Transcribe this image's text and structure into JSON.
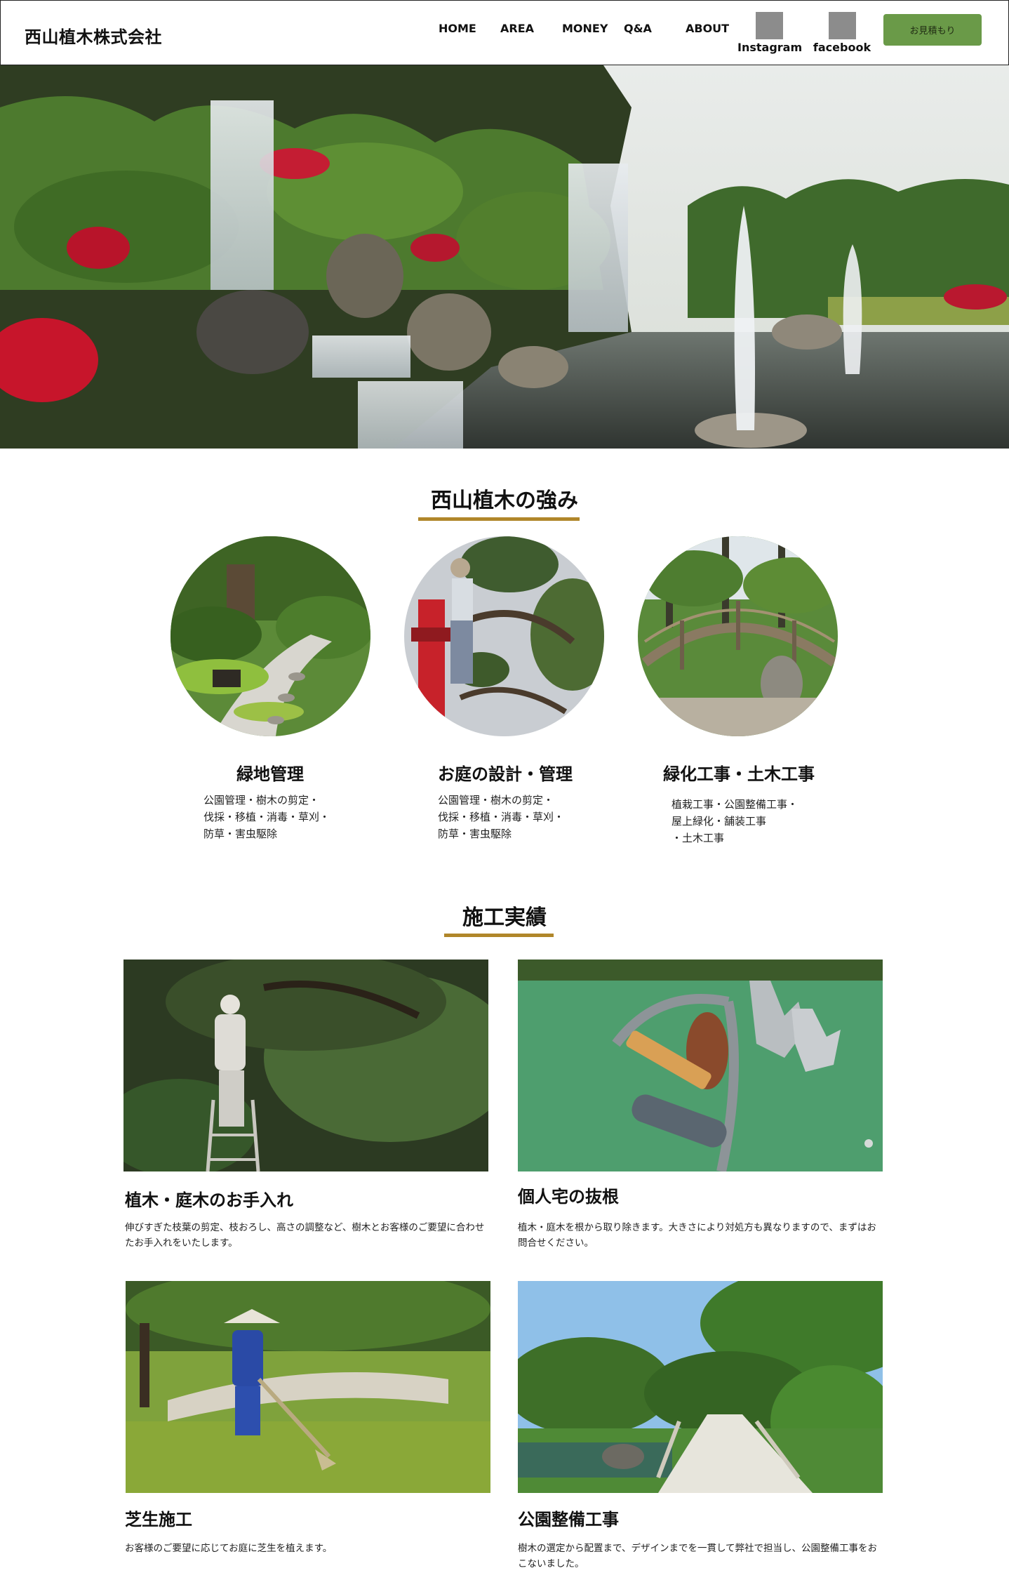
{
  "header": {
    "logo": "西山植木株式会社",
    "nav": [
      "HOME",
      "AREA",
      "MONEY",
      "Q&A",
      "ABOUT"
    ],
    "social": [
      "Instagram",
      "facebook"
    ],
    "estimate_label": "お見積もり"
  },
  "strengths": {
    "title": "西山植木の強み",
    "items": [
      {
        "title": "緑地管理",
        "desc": [
          "公園管理・樹木の剪定・",
          "伐採・移植・消毒・草刈・",
          "防草・害虫駆除"
        ]
      },
      {
        "title": "お庭の設計・管理",
        "desc": [
          "公園管理・樹木の剪定・",
          "伐採・移植・消毒・草刈・",
          "防草・害虫駆除"
        ]
      },
      {
        "title": "緑化工事・土木工事",
        "desc": [
          "植栽工事・公園整備工事・",
          "屋上緑化・舗装工事",
          "・土木工事"
        ]
      }
    ]
  },
  "works": {
    "title": "施工実績",
    "items": [
      {
        "title": "植木・庭木のお手入れ",
        "desc": "伸びすぎた枝葉の剪定、枝おろし、高さの調整など、樹木とお客様のご要望に合わせたお手入れをいたします。"
      },
      {
        "title": "個人宅の抜根",
        "desc": "植木・庭木を根から取り除きます。大きさにより対処方も異なりますので、まずはお問合せください。"
      },
      {
        "title": "芝生施工",
        "desc": "お客様のご要望に応じてお庭に芝生を植えます。"
      },
      {
        "title": "公園整備工事",
        "desc": "樹木の選定から配置まで、デザインまでを一貫して弊社で担当し、公園整備工事をおこないました。"
      }
    ]
  },
  "colors": {
    "accent_green": "#6a9a48",
    "underline_gold": "#b0862a"
  }
}
